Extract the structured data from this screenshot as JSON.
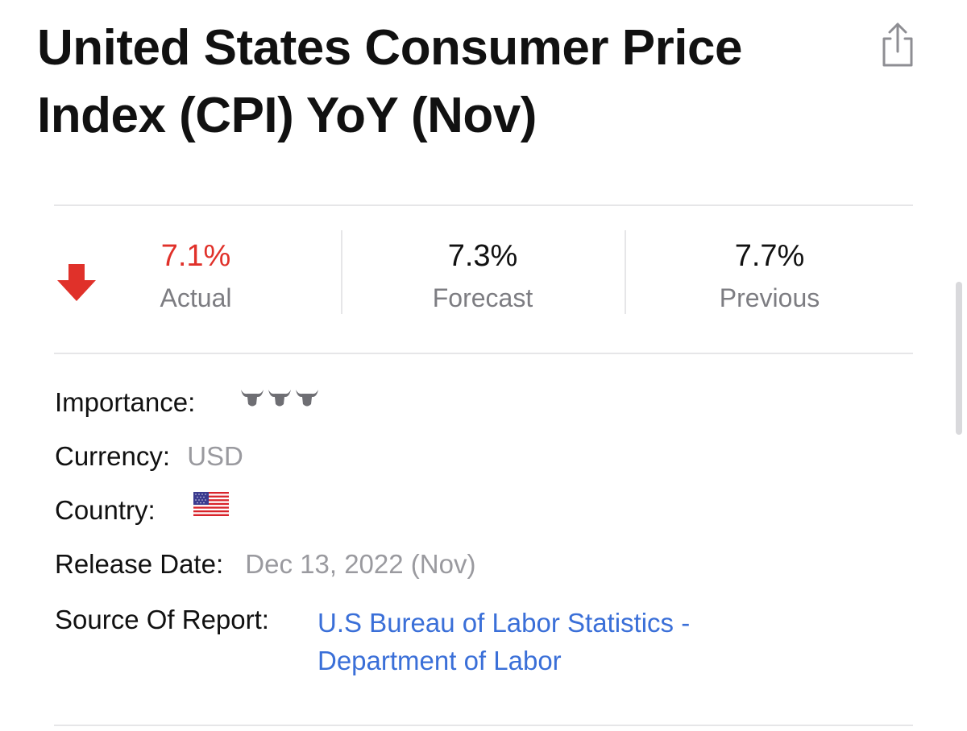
{
  "header": {
    "title_line1": "United States Consumer Price",
    "title_line2": "Index (CPI) YoY (Nov)"
  },
  "icons": {
    "share": "share-icon",
    "trend": "arrow-down-icon",
    "importance": "bull-icon",
    "country_flag": "us-flag-icon"
  },
  "colors": {
    "actual": "#e0312a",
    "link": "#3a6fd8",
    "muted": "#7d7d82"
  },
  "stats": {
    "actual": {
      "value": "7.1%",
      "label": "Actual"
    },
    "forecast": {
      "value": "7.3%",
      "label": "Forecast"
    },
    "previous": {
      "value": "7.7%",
      "label": "Previous"
    }
  },
  "details": {
    "importance_label": "Importance:",
    "importance_level": 3,
    "currency_label": "Currency:",
    "currency_value": "USD",
    "country_label": "Country:",
    "release_label": "Release Date:",
    "release_value": "Dec 13, 2022 (Nov)",
    "source_label": "Source Of Report:",
    "source_line1": "U.S Bureau of Labor Statistics -",
    "source_line2": "Department of Labor"
  }
}
